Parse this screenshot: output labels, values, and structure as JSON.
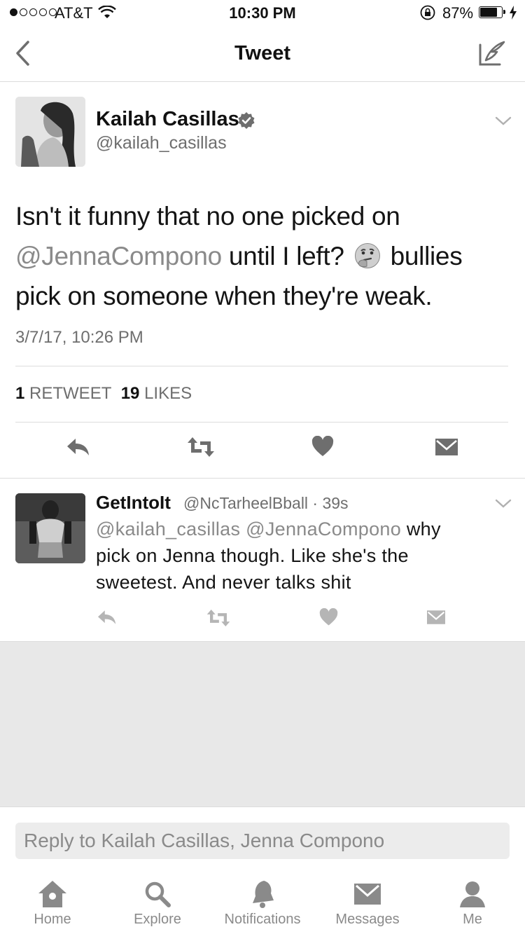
{
  "status_bar": {
    "carrier": "AT&T",
    "time": "10:30 PM",
    "battery": "87%"
  },
  "nav": {
    "title": "Tweet",
    "back_icon": "chevron-left-icon",
    "compose_icon": "compose-icon"
  },
  "tweet": {
    "name": "Kailah Casillas",
    "handle": "@kailah_casillas",
    "text_part1": "Isn't it funny that no one picked on ",
    "mention": "@JennaCompono",
    "text_part2": " until I left? ",
    "text_part3": " bullies pick on someone when they're weak.",
    "timestamp": "3/7/17, 10:26 PM",
    "retweet_count": "1",
    "retweet_label": "RETWEET",
    "like_count": "19",
    "like_label": "LIKES"
  },
  "reply": {
    "name": "GetIntoIt",
    "handle_time": "@NcTarheelBball · 39s",
    "mention1": "@kailah_casillas",
    "mention2": "@JennaCompono",
    "text_part1": " why",
    "text_part2": "pick on Jenna though. Like she's the",
    "text_part3": "sweetest. And never talks shit"
  },
  "reply_input": {
    "placeholder": "Reply to Kailah Casillas, Jenna Compono"
  },
  "tabs": [
    {
      "label": "Home",
      "icon": "home-icon"
    },
    {
      "label": "Explore",
      "icon": "search-icon"
    },
    {
      "label": "Notifications",
      "icon": "bell-icon"
    },
    {
      "label": "Messages",
      "icon": "envelope-icon"
    },
    {
      "label": "Me",
      "icon": "person-icon"
    }
  ]
}
